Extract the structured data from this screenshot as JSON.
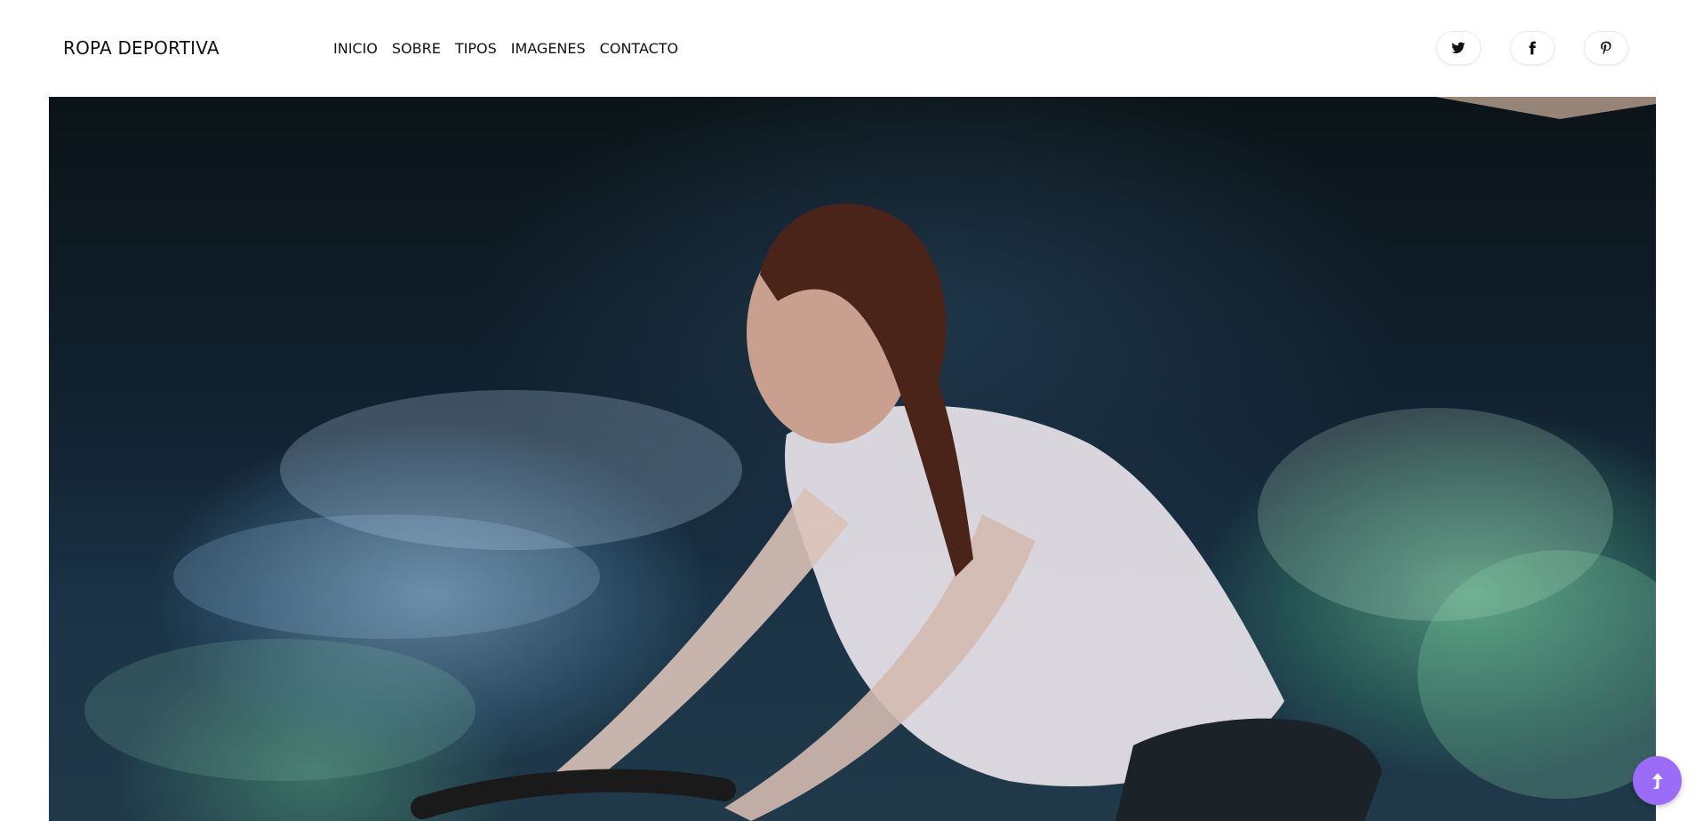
{
  "header": {
    "brand": "ROPA DEPORTIVA",
    "nav": [
      {
        "label": "INICIO"
      },
      {
        "label": "SOBRE"
      },
      {
        "label": "TIPOS"
      },
      {
        "label": "IMAGENES"
      },
      {
        "label": "CONTACTO"
      }
    ],
    "socials": [
      {
        "icon": "twitter-icon"
      },
      {
        "icon": "facebook-icon"
      },
      {
        "icon": "pinterest-icon"
      }
    ]
  },
  "hero": {
    "image": "photo of a woman riding an indoor cycling bike amid colored smoke"
  },
  "scroll_top": {
    "icon": "arrow-up-icon",
    "color": "#9b6cf7"
  }
}
